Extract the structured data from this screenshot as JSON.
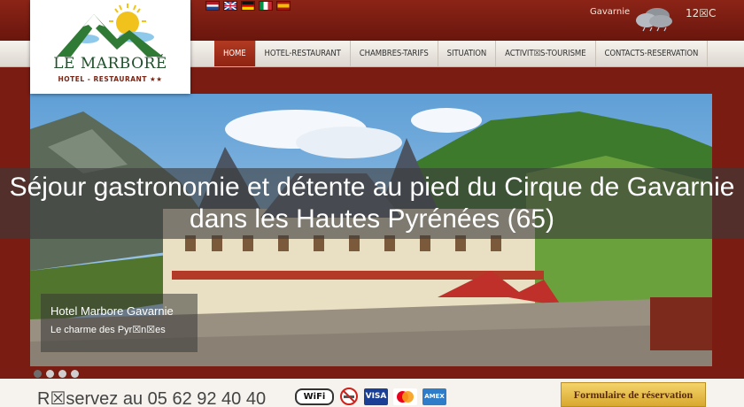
{
  "header": {
    "logo": {
      "name": "LE MARBORÉ",
      "subtitle": "HOTEL - RESTAURANT ★★"
    },
    "flags": [
      "flag-netherlands",
      "flag-uk",
      "flag-germany",
      "flag-italy",
      "flag-spain"
    ],
    "weather": {
      "location": "Gavarnie",
      "temperature": "12☒C",
      "icon": "cloudy-icon"
    }
  },
  "nav": {
    "items": [
      {
        "label": "HOME",
        "active": true
      },
      {
        "label": "HOTEL-RESTAURANT"
      },
      {
        "label": "CHAMBRES-TARIFS"
      },
      {
        "label": "SITUATION"
      },
      {
        "label": "ACTIVIT☒S-TOURISME"
      },
      {
        "label": "CONTACTS-RESERVATION"
      }
    ]
  },
  "hero": {
    "overlay": "Séjour gastronomie et détente au pied du Cirque de Gavarnie dans les Hautes Pyrénées (65)",
    "caption_title": "Hotel Marbore Gavarnie",
    "caption_subtitle": "Le charme des Pyr☒n☒es",
    "slide_count": 4,
    "active_slide": 1
  },
  "footer": {
    "phone": "R☒servez au 05 62 92 40 40",
    "wifi": "WiFi",
    "visa": "VISA",
    "amex": "AMEX",
    "reservation_button": "Formulaire de réservation"
  },
  "colors": {
    "header": "#7a1c12",
    "nav_active": "#a3301b",
    "button": "#e8c04c"
  }
}
